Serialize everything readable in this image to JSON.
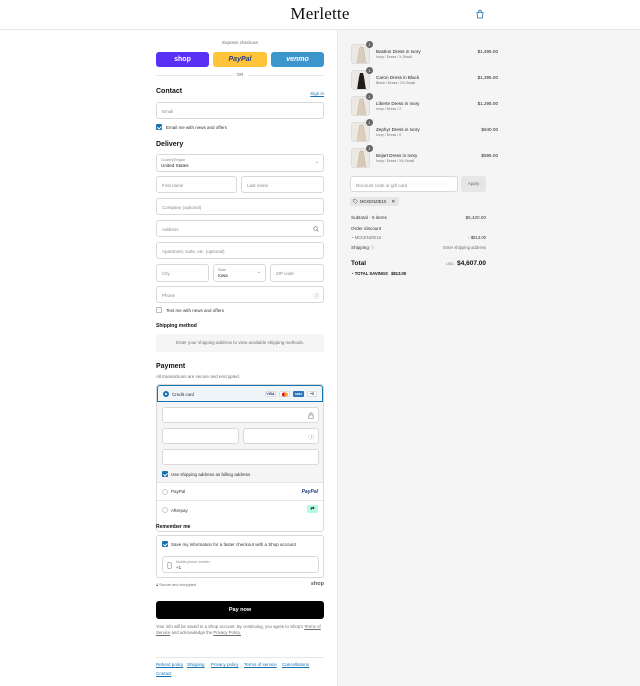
{
  "brand": "Merlette",
  "express": {
    "label": "Express checkout",
    "shop": "shop",
    "paypal": "PayPal",
    "venmo": "venmo",
    "or": "OR"
  },
  "contact": {
    "heading": "Contact",
    "signin": "Sign in",
    "email_placeholder": "Email",
    "news_label": "Email me with news and offers"
  },
  "delivery": {
    "heading": "Delivery",
    "country_label": "Country/Region",
    "country_value": "United States",
    "first_name": "First name",
    "last_name": "Last name",
    "company": "Company (optional)",
    "address": "Address",
    "apartment": "Apartment, suite, etc. (optional)",
    "city": "City",
    "state_label": "State",
    "state_value": "Iowa",
    "zip": "ZIP code",
    "phone": "Phone",
    "text_label": "Text me with news and offers"
  },
  "shipping": {
    "heading": "Shipping method",
    "message": "Enter your shipping address to view available shipping methods."
  },
  "payment": {
    "heading": "Payment",
    "subtitle": "All transactions are secure and encrypted.",
    "credit_card": "Credit card",
    "visa": "VISA",
    "amex": "AMEX",
    "more_cards": "+5",
    "billing_label": "Use shipping address as billing address",
    "paypal_option": "PayPal",
    "paypal_logo": "PayPal",
    "afterpay_option": "Afterpay"
  },
  "remember": {
    "heading": "Remember me",
    "save_label": "Save my information for a faster checkout with a Shop account",
    "phone_label": "Mobile phone number",
    "phone_value": "+1",
    "secure": "Secure and encrypted",
    "shop_logo": "shop"
  },
  "pay_now": "Pay now",
  "legal": {
    "text_1": "Your info will be saved to a Shop account. By continuing, you agree to Shop's",
    "terms": "Terms of Service",
    "text_2": "and acknowledge the",
    "privacy": "Privacy Policy."
  },
  "footer_links": [
    "Refund policy",
    "Shipping",
    "Privacy policy",
    "Terms of service",
    "Cancellations",
    "Contact"
  ],
  "cart": {
    "items": [
      {
        "name": "Bastion Dress in Ivory",
        "variant": "Ivory / Dress / X-Small",
        "qty": "1",
        "price": "$1,495.00",
        "tone": "#d8ccba"
      },
      {
        "name": "Caron Dress in Black",
        "variant": "Black / Dress / XX-Small",
        "qty": "1",
        "price": "$1,395.00",
        "tone": "#1c1c1c"
      },
      {
        "name": "Liberte Dress in Ivory",
        "variant": "Ivory / Dress / 2",
        "qty": "1",
        "price": "$1,295.00",
        "tone": "#d9cdb9"
      },
      {
        "name": "Zephyr Dress in Ivory",
        "variant": "Ivory / Dress / 0",
        "qty": "1",
        "price": "$640.00",
        "tone": "#dccfbc"
      },
      {
        "name": "Bejart Dress in Ivory",
        "variant": "Ivory / Dress / XX-Small",
        "qty": "1",
        "price": "$595.00",
        "tone": "#d6c9b5"
      }
    ],
    "discount_placeholder": "Discount code or gift card",
    "apply": "Apply",
    "code_tag": "MCKENZIE15",
    "subtotal_label": "Subtotal · 5 items",
    "subtotal_value": "$5,420.00",
    "order_discount_label": "Order discount",
    "discount_code": "MCKENZIE15",
    "discount_value": "- $813.00",
    "shipping_label": "Shipping",
    "shipping_value": "Enter shipping address",
    "total_label": "Total",
    "currency": "USD",
    "total_value": "$4,607.00",
    "savings_label": "TOTAL SAVINGS",
    "savings_value": "$813.00"
  },
  "colors": {
    "shop": "#5a31f4",
    "paypal": "#ffc439",
    "venmo": "#3d95ce",
    "link": "#1773b0",
    "afterpay": "#b2fce4"
  }
}
